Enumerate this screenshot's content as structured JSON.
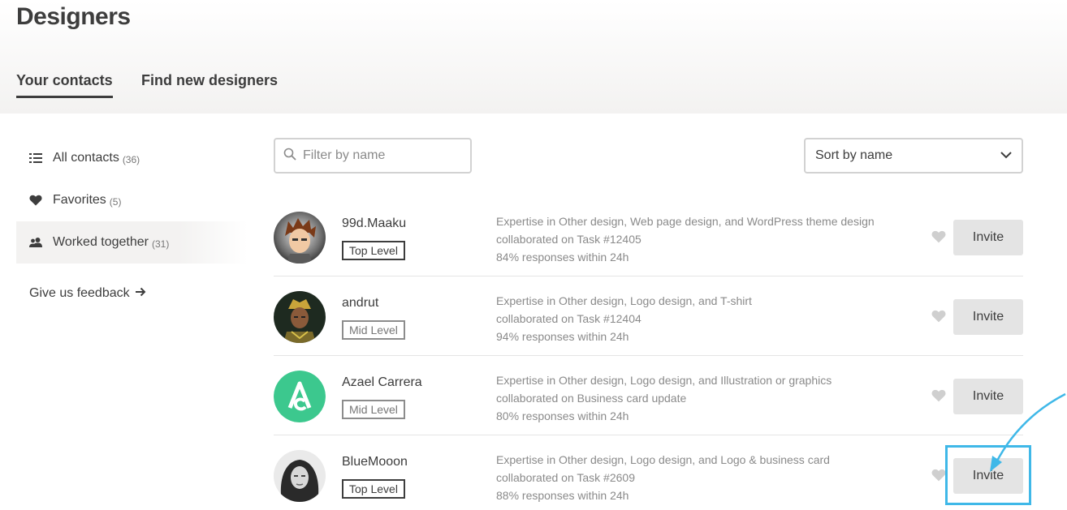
{
  "page": {
    "title": "Designers"
  },
  "tabs": [
    {
      "label": "Your contacts",
      "active": true
    },
    {
      "label": "Find new designers",
      "active": false
    }
  ],
  "sidebar": {
    "items": [
      {
        "label": "All contacts",
        "count": "(36)",
        "icon": "list-icon"
      },
      {
        "label": "Favorites",
        "count": "(5)",
        "icon": "heart-icon"
      },
      {
        "label": "Worked together",
        "count": "(31)",
        "icon": "people-icon",
        "active": true
      }
    ],
    "feedback": {
      "label": "Give us feedback",
      "icon": "arrow-right-icon"
    }
  },
  "filter": {
    "placeholder": "Filter by name",
    "value": ""
  },
  "sort": {
    "selected": "Sort by name"
  },
  "designers": [
    {
      "name": "99d.Maaku",
      "level": "Top Level",
      "expertise": "Expertise in Other design, Web page design, and WordPress theme design",
      "collaboration": "collaborated on Task #12405",
      "responses": "84% responses within 24h",
      "invite_label": "Invite"
    },
    {
      "name": "andrut",
      "level": "Mid Level",
      "expertise": "Expertise in Other design, Logo design, and T-shirt",
      "collaboration": "collaborated on Task #12404",
      "responses": "94% responses within 24h",
      "invite_label": "Invite"
    },
    {
      "name": "Azael Carrera",
      "level": "Mid Level",
      "expertise": "Expertise in Other design, Logo design, and Illustration or graphics",
      "collaboration": "collaborated on Business card update",
      "responses": "80% responses within 24h",
      "invite_label": "Invite"
    },
    {
      "name": "BlueMooon",
      "level": "Top Level",
      "expertise": "Expertise in Other design, Logo design, and Logo & business card",
      "collaboration": "collaborated on Task #2609",
      "responses": "88% responses within 24h",
      "invite_label": "Invite"
    }
  ],
  "colors": {
    "accent": "#3fb8e8",
    "text": "#3d3d3d",
    "muted": "#8a8a8a",
    "button_bg": "#e4e4e4",
    "azael_avatar": "#3cc88e"
  }
}
